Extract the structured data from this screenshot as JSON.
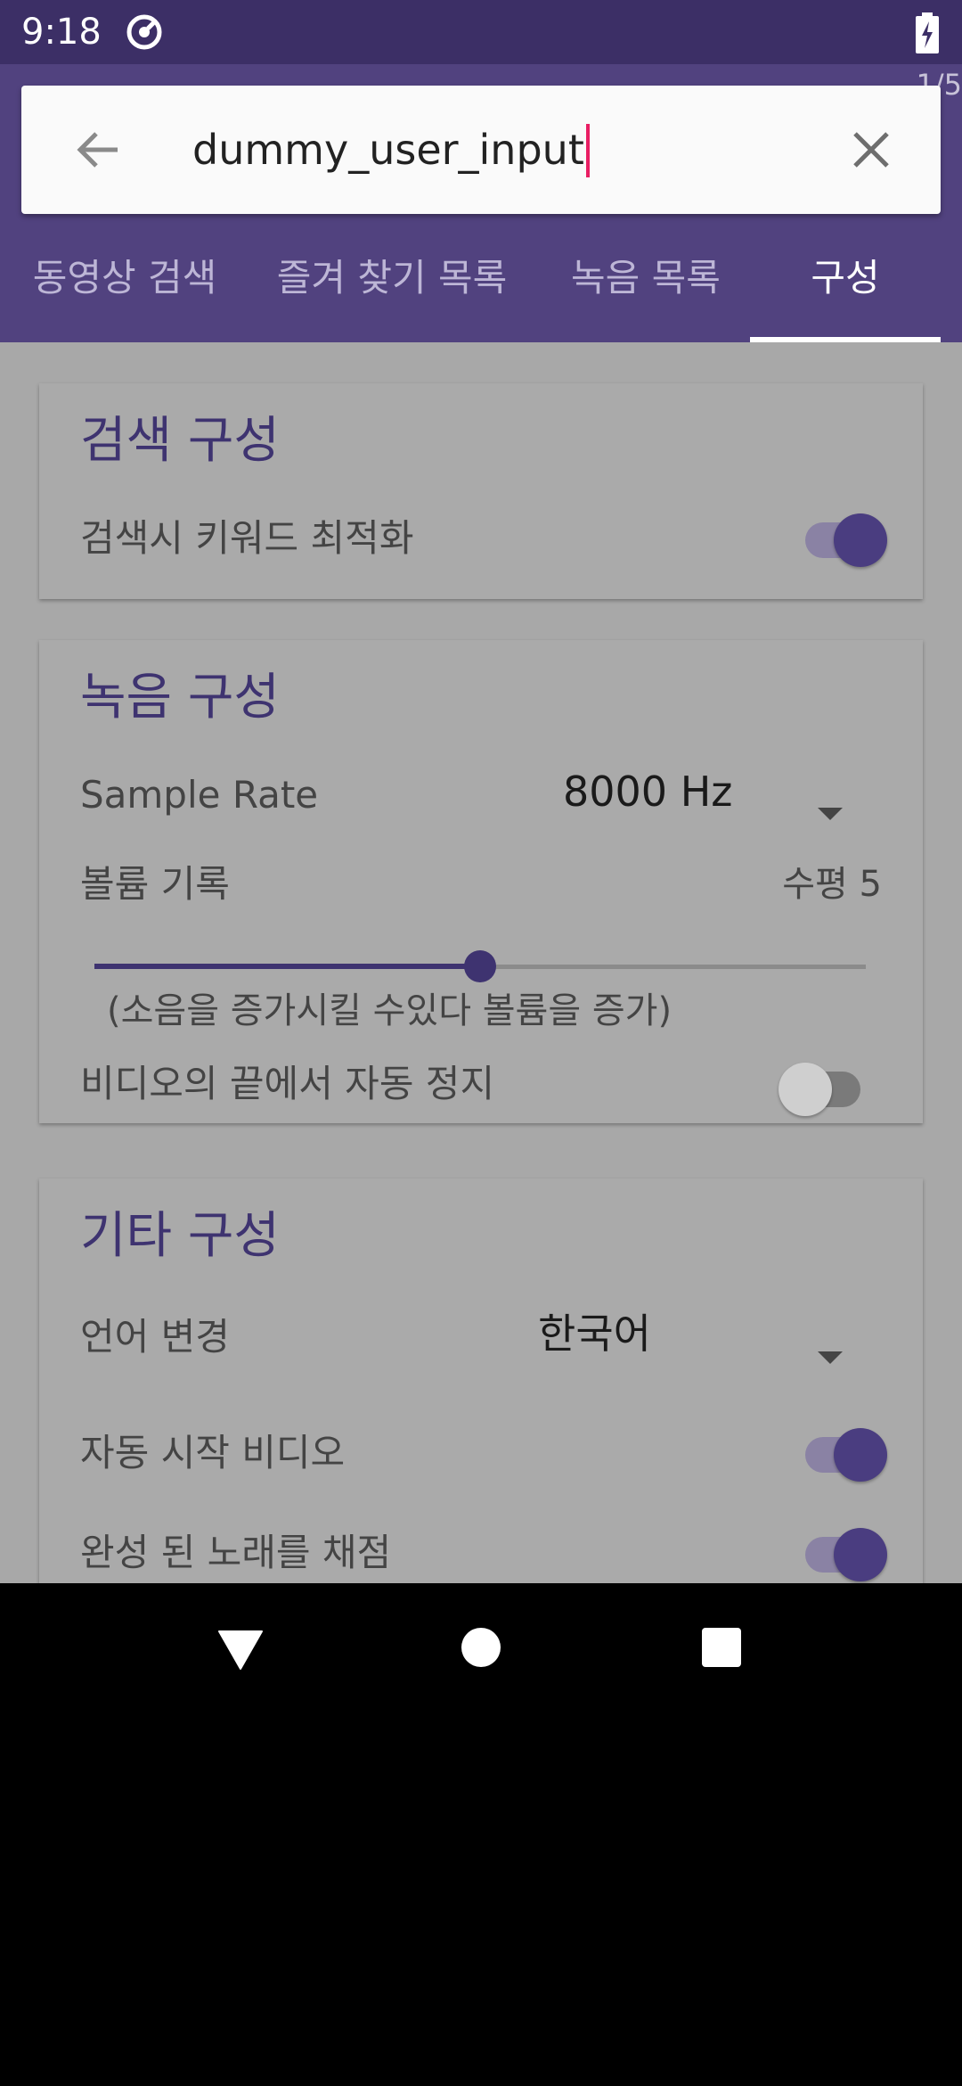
{
  "status": {
    "time": "9:18",
    "app_icon": "vpn-key-icon",
    "battery_icon": "battery-charging-icon"
  },
  "header": {
    "page_counter": "1/5",
    "search": {
      "value": "dummy_user_input",
      "placeholder": ""
    },
    "back_icon": "arrow-back-icon",
    "clear_icon": "close-icon",
    "tabs": [
      {
        "label": "동영상 검색",
        "active": false
      },
      {
        "label": "즐겨 찾기 목록",
        "active": false
      },
      {
        "label": "녹음 목록",
        "active": false
      },
      {
        "label": "구성",
        "active": true
      }
    ]
  },
  "search_settings": {
    "title": "검색 구성",
    "keyword_opt": {
      "label": "검색시 키워드 최적화",
      "on": true
    }
  },
  "record_settings": {
    "title": "녹음 구성",
    "sample_rate": {
      "label": "Sample Rate",
      "value": "8000 Hz"
    },
    "volume": {
      "label": "볼륨 기록",
      "level_text": "수평 5",
      "fraction": 0.5,
      "hint": "(소음을 증가시킬 수있다 볼륨을 증가)"
    },
    "auto_stop": {
      "label": "비디오의 끝에서 자동 정지",
      "on": false
    }
  },
  "other_settings": {
    "title": "기타 구성",
    "language": {
      "label": "언어 변경",
      "value": "한국어"
    },
    "autoplay": {
      "label": "자동 시작 비디오",
      "on": true
    },
    "score": {
      "label": "완성 된 노래를 채점",
      "on": true
    }
  },
  "nav": {
    "back_icon": "nav-back-triangle-icon",
    "home_icon": "nav-home-circle-icon",
    "recents_icon": "nav-recents-square-icon"
  },
  "colors": {
    "primary": "#51427f",
    "primary_dark": "#3c2f66",
    "accent": "#e91e63",
    "switch_on": "#4a3d80"
  }
}
